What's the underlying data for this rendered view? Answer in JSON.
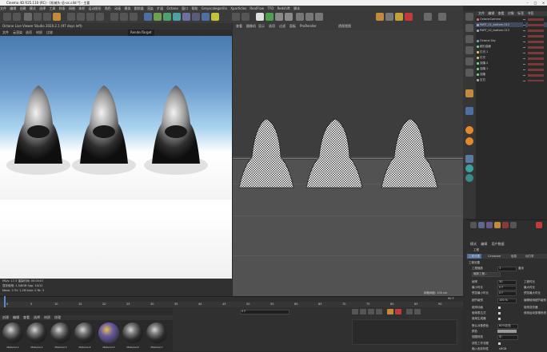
{
  "window": {
    "title": "Cinema 4D R25.110 (RC) - [机械头-总-oc.c4d *] - 主要",
    "controls": [
      "–",
      "□",
      "×"
    ]
  },
  "menu": [
    "文件",
    "编辑",
    "创建",
    "模式",
    "选择",
    "工具",
    "样条",
    "网格",
    "体积",
    "运动图形",
    "角色",
    "动画",
    "模拟",
    "跟踪器",
    "渲染",
    "扩展",
    "Octane",
    "窗口",
    "帮助",
    "Greyscalegorilla",
    "Xparticles",
    "RealFlow",
    "TFD",
    "Redshift",
    "脚本"
  ],
  "render_viewport": {
    "header": "Octane Live Viewer Studio 2020.2.1 (97 days left)",
    "subbar": [
      "文件",
      "云渲染",
      "选项",
      "材质",
      "比较"
    ],
    "tag": "RenderTarget",
    "info": [
      "MS/s: 17.3 渲染时间: 00:00:07",
      "显存使用: 1.5/8GB  Spp: 10/12",
      "Mesh: 3 Tri: 1.2M  Hair: 0  Rt: 3"
    ]
  },
  "edit_viewport": {
    "menu": [
      "查看",
      "摄像机",
      "显示",
      "选项",
      "过滤",
      "面板",
      "ProRender"
    ],
    "label": "透视视图",
    "grid_label": "网格间距: 100 cm"
  },
  "timeline": {
    "ticks": [
      "0",
      "5",
      "10",
      "15",
      "20",
      "25",
      "30",
      "35",
      "40",
      "45",
      "50",
      "55",
      "60",
      "65",
      "70",
      "75",
      "80",
      "85",
      "90"
    ],
    "frame_start": "0 F",
    "frame_end": "90 F",
    "current": "0 F"
  },
  "material_panel": {
    "menu": [
      "创建",
      "编辑",
      "查看",
      "选择",
      "材质",
      "纹理"
    ],
    "materials": [
      "Material.1",
      "Material.2",
      "Material.3",
      "Material.4",
      "Material.5",
      "Material.6",
      "Material.7",
      "Material.8"
    ]
  },
  "object_manager": {
    "menu": [
      "文件",
      "编辑",
      "查看",
      "对象",
      "标签",
      "书签"
    ],
    "items": [
      {
        "name": "OctaneCamera",
        "color": "#d46f6f"
      },
      {
        "name": "PART_01_bottom.012",
        "color": "#9fa7c9"
      },
      {
        "name": "PART_02_bottom.013",
        "color": "#9fa7c9"
      },
      {
        "name": "Octane Sky",
        "color": "#6fa0d4"
      },
      {
        "name": "细分曲面",
        "color": "#6fd48f"
      },
      {
        "name": "灯光.1",
        "color": "#d4c26f"
      },
      {
        "name": "灯光",
        "color": "#d4c26f"
      },
      {
        "name": "克隆.2",
        "color": "#6fd48f"
      },
      {
        "name": "克隆.1",
        "color": "#6fd48f"
      },
      {
        "name": "克隆",
        "color": "#6fd48f"
      },
      {
        "name": "空白",
        "color": "#aaaaaa"
      }
    ]
  },
  "attributes": {
    "menu": [
      "模式",
      "编辑",
      "用户数据"
    ],
    "title": "工程",
    "tabs": [
      "工程设置",
      "Cineware",
      "信息",
      "动力学"
    ],
    "section": "工程设置",
    "rows": [
      {
        "label": "工程缩放",
        "value": "1",
        "unit": "厘米"
      },
      {
        "label": "缩放工程...",
        "value": ""
      },
      {
        "label": "帧率",
        "value": "30"
      },
      {
        "label": "最小时长",
        "value": "0 F"
      },
      {
        "label": "预览最小时长",
        "value": "0 F"
      },
      {
        "label": "细节级别",
        "value": "100 %"
      },
      {
        "label": "使用动画",
        "value": ""
      },
      {
        "label": "使用表达式",
        "value": ""
      },
      {
        "label": "使用生成器",
        "value": ""
      },
      {
        "label": "默认对象颜色",
        "value": "60%灰色"
      },
      {
        "label": "颜色",
        "value": ""
      },
      {
        "label": "视图修剪",
        "value": "中"
      },
      {
        "label": "线性工作流程",
        "value": ""
      },
      {
        "label": "输入色彩特性",
        "value": "sRGB"
      }
    ],
    "right_rows": [
      "工程时长",
      "最大时长",
      "预览最大时长",
      "编辑使用细节级别",
      "使用变形器",
      "使用运动剪辑系统"
    ]
  },
  "accent": "#e6a23c"
}
